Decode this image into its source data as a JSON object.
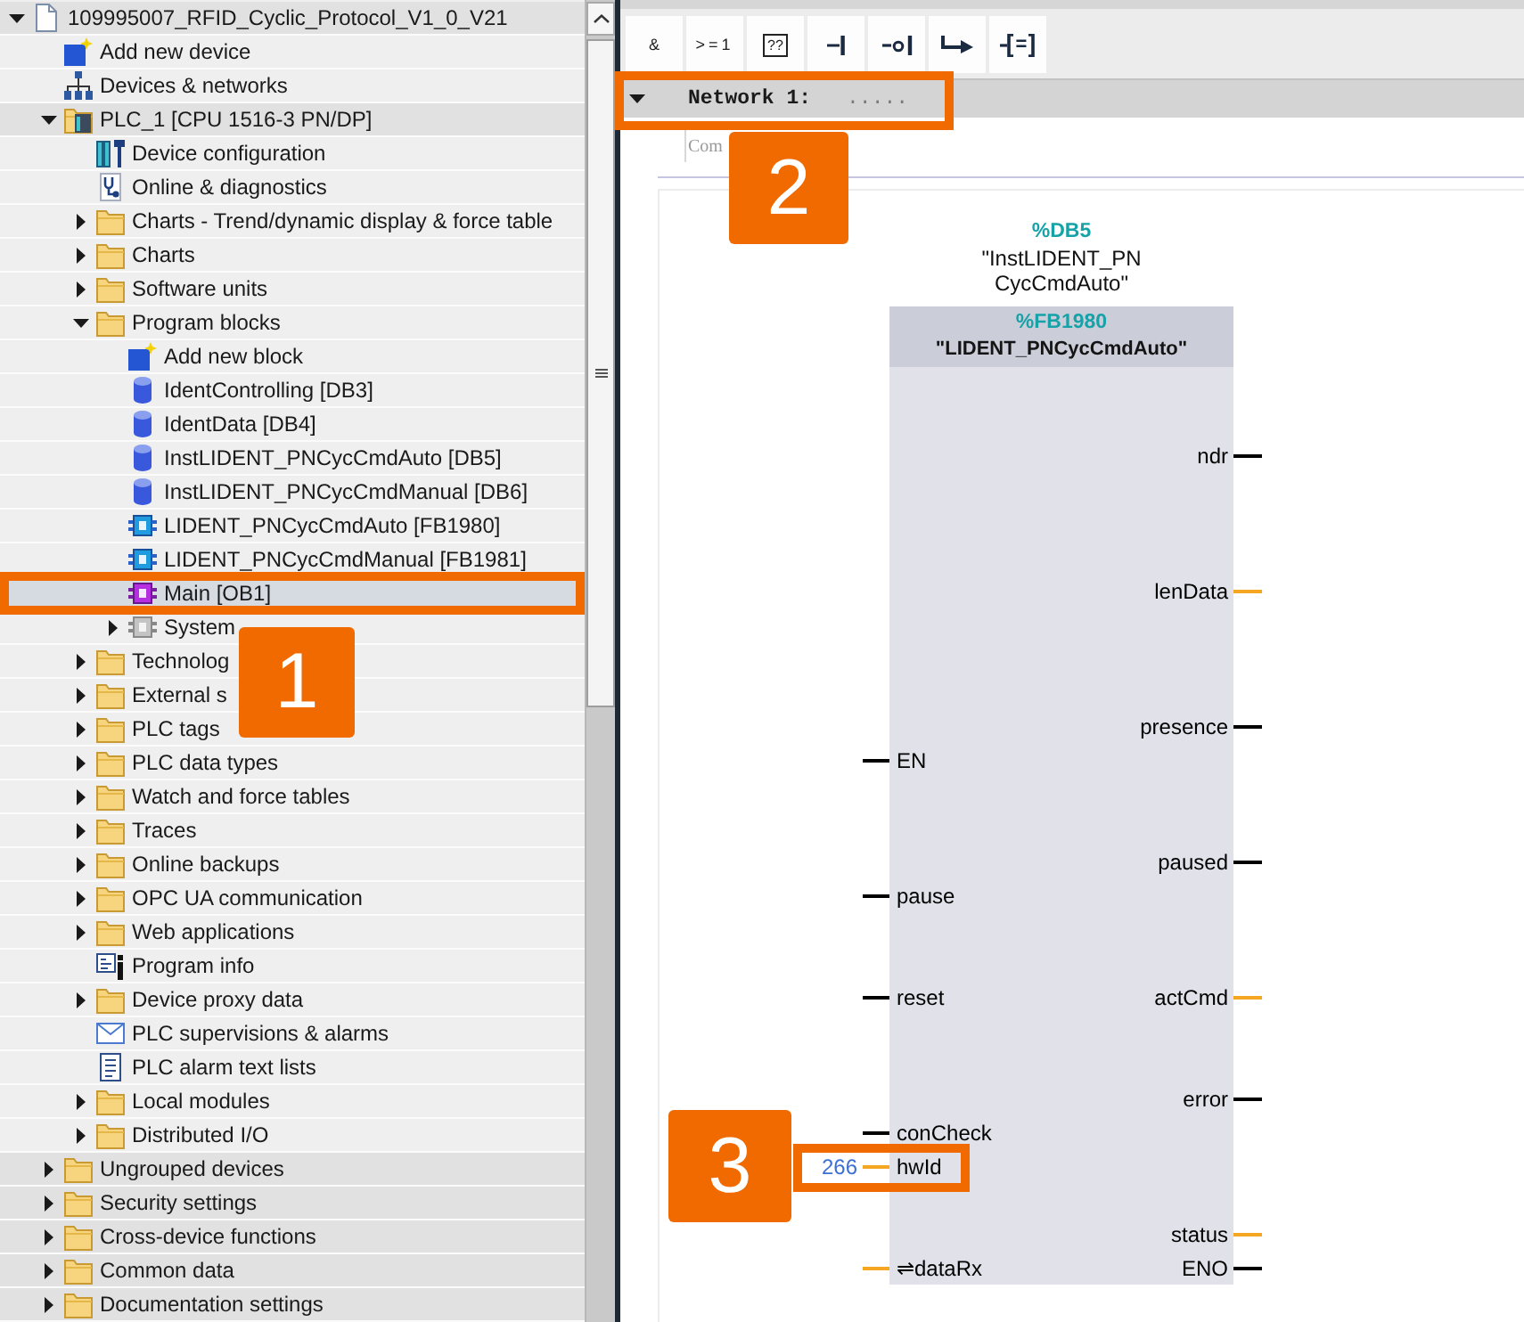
{
  "project_tree": {
    "items": [
      {
        "label": "109995007_RFID_Cyclic_Protocol_V1_0_V21",
        "kind": "project",
        "expanded": true,
        "selected": false,
        "children": [
          {
            "label": "Add new device",
            "kind": "add",
            "selected": false
          },
          {
            "label": "Devices & networks",
            "kind": "network",
            "selected": false
          },
          {
            "label": "PLC_1 [CPU 1516-3 PN/DP]",
            "kind": "plc",
            "expanded": true,
            "selected": false,
            "children": [
              {
                "label": "Device configuration",
                "kind": "config",
                "selected": false
              },
              {
                "label": "Online & diagnostics",
                "kind": "diagnostics",
                "selected": false
              },
              {
                "label": "Charts - Trend/dynamic display & force table",
                "kind": "folder",
                "expanded": false,
                "selected": false
              },
              {
                "label": "Charts",
                "kind": "folder",
                "expanded": false,
                "selected": false
              },
              {
                "label": "Software units",
                "kind": "folder",
                "expanded": false,
                "selected": false
              },
              {
                "label": "Program blocks",
                "kind": "folder",
                "expanded": true,
                "selected": false,
                "children": [
                  {
                    "label": "Add new block",
                    "kind": "add",
                    "selected": false
                  },
                  {
                    "label": "IdentControlling [DB3]",
                    "kind": "db",
                    "selected": false
                  },
                  {
                    "label": "IdentData [DB4]",
                    "kind": "db",
                    "selected": false
                  },
                  {
                    "label": "InstLIDENT_PNCycCmdAuto [DB5]",
                    "kind": "db",
                    "selected": false
                  },
                  {
                    "label": "InstLIDENT_PNCycCmdManual [DB6]",
                    "kind": "db",
                    "selected": false
                  },
                  {
                    "label": "LIDENT_PNCycCmdAuto [FB1980]",
                    "kind": "fb",
                    "selected": false
                  },
                  {
                    "label": "LIDENT_PNCycCmdManual [FB1981]",
                    "kind": "fb",
                    "selected": false
                  },
                  {
                    "label": "Main [OB1]",
                    "kind": "ob",
                    "selected": true,
                    "callout": "1"
                  },
                  {
                    "label": "System",
                    "kind": "system",
                    "expanded": false,
                    "selected": false
                  }
                ]
              },
              {
                "label": "Technolog",
                "kind": "folder",
                "expanded": false,
                "selected": false
              },
              {
                "label": "External s",
                "kind": "folder",
                "expanded": false,
                "selected": false
              },
              {
                "label": "PLC tags",
                "kind": "folder",
                "expanded": false,
                "selected": false
              },
              {
                "label": "PLC data types",
                "kind": "folder",
                "expanded": false,
                "selected": false
              },
              {
                "label": "Watch and force tables",
                "kind": "folder",
                "expanded": false,
                "selected": false
              },
              {
                "label": "Traces",
                "kind": "folder",
                "expanded": false,
                "selected": false
              },
              {
                "label": "Online backups",
                "kind": "folder",
                "expanded": false,
                "selected": false
              },
              {
                "label": "OPC UA communication",
                "kind": "folder",
                "expanded": false,
                "selected": false
              },
              {
                "label": "Web applications",
                "kind": "folder",
                "expanded": false,
                "selected": false
              },
              {
                "label": "Program info",
                "kind": "info",
                "selected": false
              },
              {
                "label": "Device proxy data",
                "kind": "folder",
                "expanded": false,
                "selected": false
              },
              {
                "label": "PLC supervisions & alarms",
                "kind": "alarm",
                "selected": false
              },
              {
                "label": "PLC alarm text lists",
                "kind": "textlist",
                "selected": false
              },
              {
                "label": "Local modules",
                "kind": "folder",
                "expanded": false,
                "selected": false
              },
              {
                "label": "Distributed I/O",
                "kind": "folder",
                "expanded": false,
                "selected": false
              }
            ]
          },
          {
            "label": "Ungrouped devices",
            "kind": "folder",
            "expanded": false,
            "selected": false
          },
          {
            "label": "Security settings",
            "kind": "folder",
            "expanded": false,
            "selected": false
          },
          {
            "label": "Cross-device functions",
            "kind": "folder",
            "expanded": false,
            "selected": false
          },
          {
            "label": "Common data",
            "kind": "folder",
            "expanded": false,
            "selected": false
          },
          {
            "label": "Documentation settings",
            "kind": "folder",
            "expanded": false,
            "selected": false
          }
        ]
      }
    ]
  },
  "toolbar": {
    "buttons": [
      {
        "kind": "and",
        "label": "&"
      },
      {
        "kind": "or",
        "label": ">=1"
      },
      {
        "kind": "box",
        "label": "??"
      },
      {
        "kind": "contact"
      },
      {
        "kind": "negated-contact"
      },
      {
        "kind": "branch"
      },
      {
        "kind": "assignment",
        "label": "="
      }
    ]
  },
  "network": {
    "expanded": true,
    "label": "Network 1:",
    "title": ".....",
    "callout": "2",
    "comment": {
      "placeholder": "Com"
    },
    "block": {
      "instance_address": "%DB5",
      "instance_name": "\"InstLIDENT_PN\nCycCmdAuto\"",
      "address": "%FB1980",
      "name": "\"LIDENT_PNCycCmdAuto\"",
      "inputs": [
        {
          "name": "EN",
          "color": "#000000"
        },
        {
          "name": "pause",
          "color": "#000000"
        },
        {
          "name": "reset",
          "color": "#000000"
        },
        {
          "name": "conCheck",
          "color": "#000000"
        },
        {
          "name": "hwId",
          "color": "#f5a623",
          "operand": "266",
          "callout": "3"
        },
        {
          "name": "⇌dataRx",
          "color": "#f5a623"
        }
      ],
      "outputs": [
        {
          "name": "ndr",
          "color": "#000000"
        },
        {
          "name": "lenData",
          "color": "#f5a623"
        },
        {
          "name": "presence",
          "color": "#000000"
        },
        {
          "name": "paused",
          "color": "#000000"
        },
        {
          "name": "actCmd",
          "color": "#f5a623"
        },
        {
          "name": "error",
          "color": "#000000"
        },
        {
          "name": "status",
          "color": "#f5a623"
        },
        {
          "name": "ENO",
          "color": "#000000"
        }
      ]
    }
  }
}
